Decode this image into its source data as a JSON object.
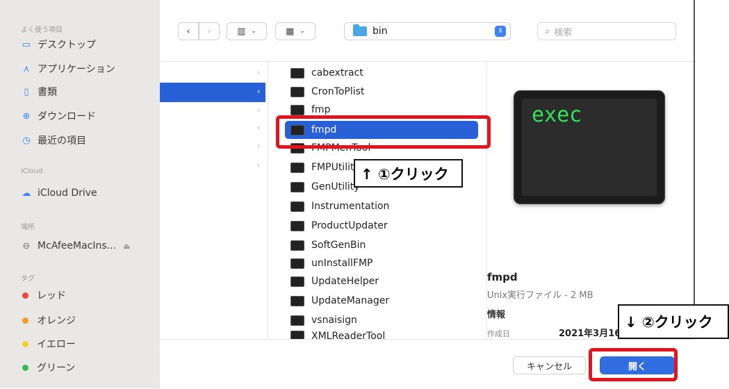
{
  "sidebar": {
    "favorites_header": "よく使う項目",
    "favorites": [
      {
        "label": "デスクトップ",
        "icon": "desktop-icon"
      },
      {
        "label": "アプリケーション",
        "icon": "applications-icon"
      },
      {
        "label": "書類",
        "icon": "document-icon"
      },
      {
        "label": "ダウンロード",
        "icon": "download-icon"
      },
      {
        "label": "最近の項目",
        "icon": "clock-icon"
      }
    ],
    "icloud_header": "iCloud",
    "icloud_drive": "iCloud Drive",
    "locations_header": "場所",
    "location_item": "McAfeeMacIns...",
    "tags_header": "タグ",
    "tags": [
      {
        "label": "レッド",
        "color": "#e8453c"
      },
      {
        "label": "オレンジ",
        "color": "#f29b2e"
      },
      {
        "label": "イエロー",
        "color": "#f5d033"
      },
      {
        "label": "グリーン",
        "color": "#3dbb4e"
      }
    ]
  },
  "toolbar": {
    "current_folder": "bin",
    "search_placeholder": "検索"
  },
  "files": [
    "cabextract",
    "CronToPlist",
    "fmp",
    "fmpd",
    "FMPMenTool",
    "FMPUtility",
    "GenUtility",
    "Instrumentation",
    "ProductUpdater",
    "SoftGenBin",
    "unInstallFMP",
    "UpdateHelper",
    "UpdateManager",
    "vsnaisign",
    "XMLReaderTool"
  ],
  "selected_file": "fmpd",
  "preview": {
    "icon_text": "exec",
    "name": "fmpd",
    "kind": "Unix実行ファイル - 2 MB",
    "info_header": "情報",
    "created_label": "作成日",
    "created_value": "2021年3月16日"
  },
  "buttons": {
    "cancel": "キャンセル",
    "open": "開く"
  },
  "annotations": {
    "step1": "↑ ①クリック",
    "step2": "↓ ②クリック"
  },
  "colors": {
    "selection": "#2860d8",
    "annotation_red": "#e4141e",
    "exec_text": "#2ee65a"
  }
}
